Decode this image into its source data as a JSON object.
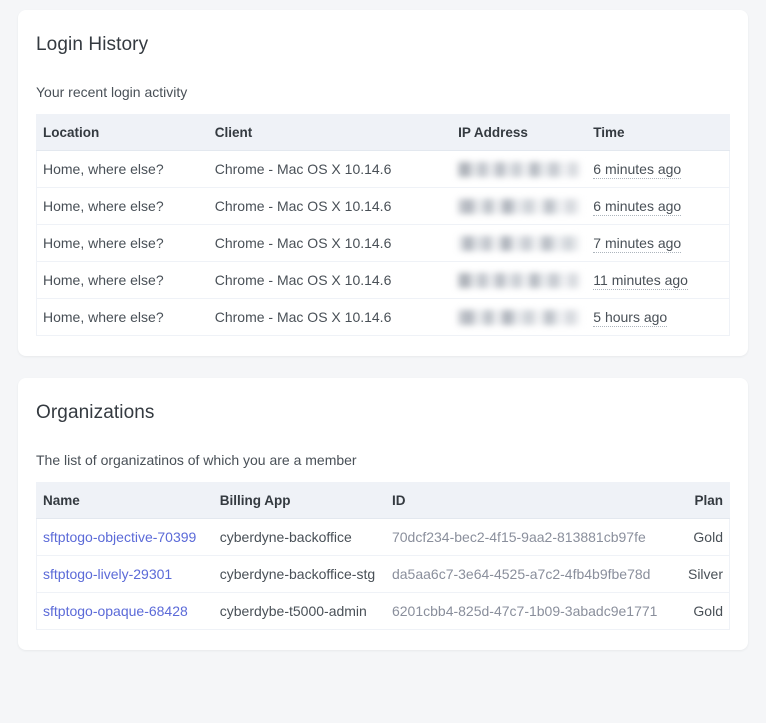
{
  "login_history": {
    "title": "Login History",
    "subtitle": "Your recent login activity",
    "columns": {
      "location": "Location",
      "client": "Client",
      "ip_address": "IP Address",
      "time": "Time"
    },
    "rows": [
      {
        "location": "Home, where else?",
        "client": "Chrome - Mac OS X 10.14.6",
        "ip_address": "",
        "time": "6 minutes ago"
      },
      {
        "location": "Home, where else?",
        "client": "Chrome - Mac OS X 10.14.6",
        "ip_address": "",
        "time": "6 minutes ago"
      },
      {
        "location": "Home, where else?",
        "client": "Chrome - Mac OS X 10.14.6",
        "ip_address": "",
        "time": "7 minutes ago"
      },
      {
        "location": "Home, where else?",
        "client": "Chrome - Mac OS X 10.14.6",
        "ip_address": "",
        "time": "11 minutes ago"
      },
      {
        "location": "Home, where else?",
        "client": "Chrome - Mac OS X 10.14.6",
        "ip_address": "",
        "time": "5 hours ago"
      }
    ]
  },
  "organizations": {
    "title": "Organizations",
    "subtitle": "The list of organizatinos of which you are a member",
    "columns": {
      "name": "Name",
      "billing_app": "Billing App",
      "id": "ID",
      "plan": "Plan"
    },
    "rows": [
      {
        "name": "sftptogo-objective-70399",
        "billing_app": "cyberdyne-backoffice",
        "id": "70dcf234-bec2-4f15-9aa2-813881cb97fe",
        "plan": "Gold"
      },
      {
        "name": "sftptogo-lively-29301",
        "billing_app": "cyberdyne-backoffice-stg",
        "id": "da5aa6c7-3e64-4525-a7c2-4fb4b9fbe78d",
        "plan": "Silver"
      },
      {
        "name": "sftptogo-opaque-68428",
        "billing_app": "cyberdybe-t5000-admin",
        "id": "6201cbb4-825d-47c7-1b09-3abadc9e1771",
        "plan": "Gold"
      }
    ]
  },
  "colors": {
    "page_background": "#f5f6f8",
    "card_background": "#ffffff",
    "table_header_background": "#eff2f7",
    "link": "#5b6ad8",
    "muted_text": "#8a8f9c",
    "body_text": "#495057",
    "heading_text": "#343a40"
  }
}
